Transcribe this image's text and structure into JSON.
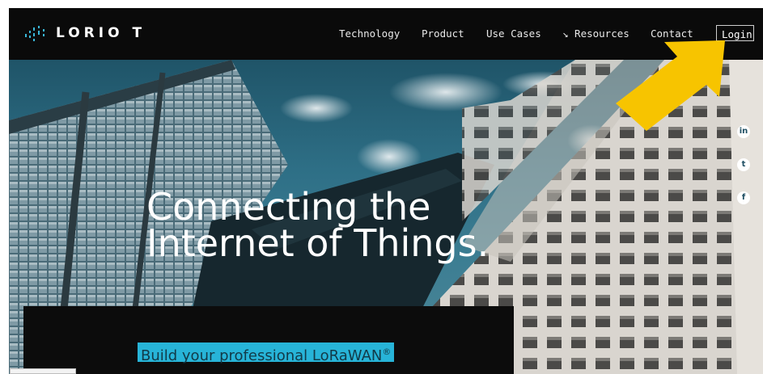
{
  "brand": {
    "name": "LORIO T"
  },
  "nav": {
    "items": [
      {
        "label": "Technology"
      },
      {
        "label": "Product"
      },
      {
        "label": "Use Cases"
      },
      {
        "label": "↘ Resources"
      },
      {
        "label": "Contact"
      }
    ],
    "login_label": "Login"
  },
  "hero": {
    "headline_line1": "Connecting the",
    "headline_line2": "Internet of Things.",
    "subheading": "Build your professional LoRaWAN",
    "subheading_mark": "®"
  },
  "social": [
    {
      "icon": "linkedin-icon",
      "glyph": "in"
    },
    {
      "icon": "twitter-icon",
      "glyph": "t"
    },
    {
      "icon": "facebook-icon",
      "glyph": "f"
    }
  ],
  "colors": {
    "accent": "#27b4d8",
    "arrow": "#f7c400",
    "nav_bg": "#0a0a0a"
  }
}
